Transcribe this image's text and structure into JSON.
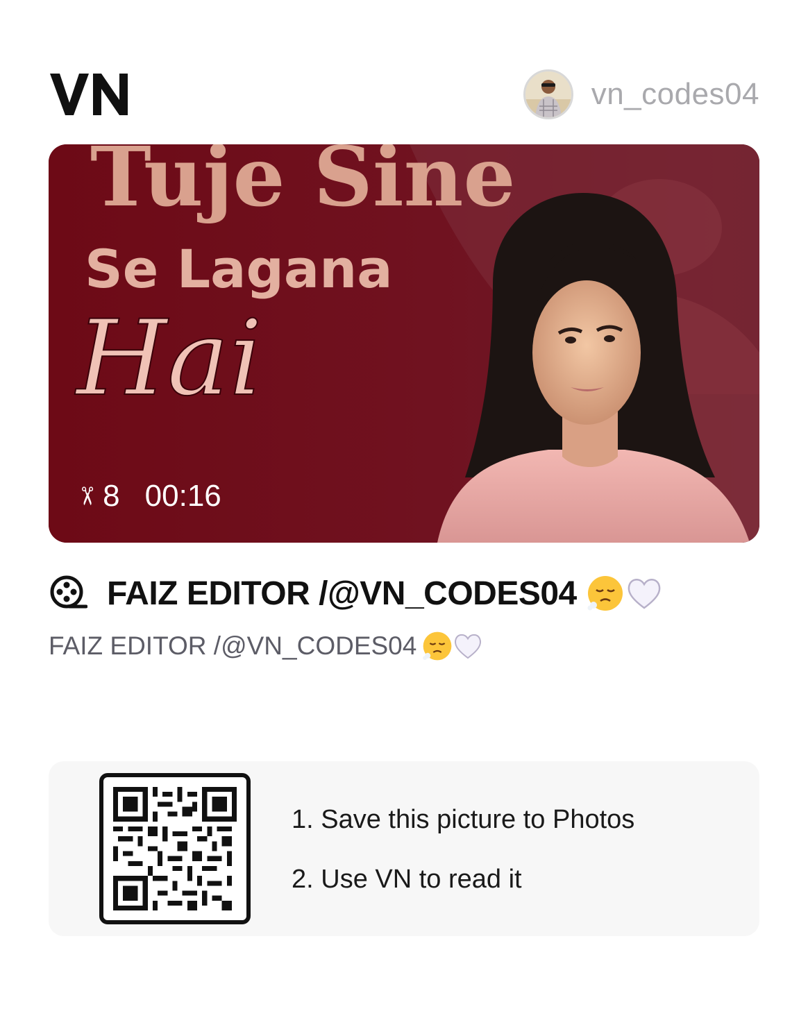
{
  "app": {
    "logo_text": "VN",
    "username": "vn_codes04"
  },
  "thumbnail": {
    "line1": "Tuje Sine",
    "line2": "Se Lagana",
    "line3": "Hai",
    "clip_count": "8",
    "duration": "00:16",
    "bg_color": "#6b0c18"
  },
  "project": {
    "icon": "film-reel-icon",
    "title": "FAIZ EDITOR /@VN_CODES04",
    "description": "FAIZ EDITOR /@VN_CODES04"
  },
  "qr": {
    "step1": "1. Save this picture to Photos",
    "step2": "2. Use VN to read it"
  }
}
